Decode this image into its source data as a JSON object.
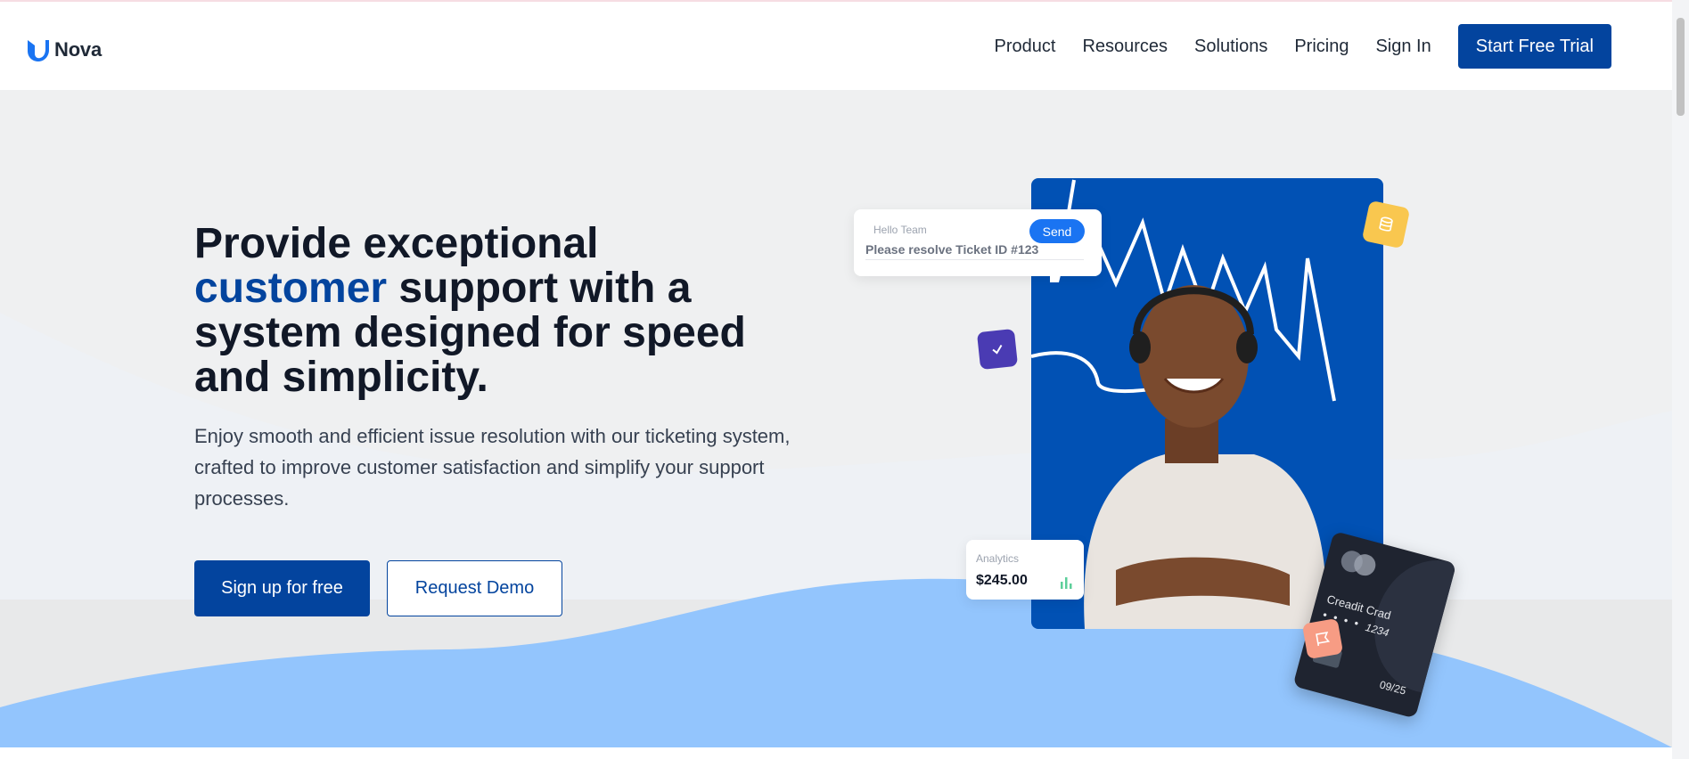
{
  "brand": {
    "name": "Nova",
    "logo_icon": "nova-logo-icon",
    "primary_color": "#03449e"
  },
  "nav": {
    "items": [
      "Product",
      "Resources",
      "Solutions",
      "Pricing",
      "Sign In"
    ],
    "cta": "Start Free Trial"
  },
  "hero": {
    "headline_before": "Provide exceptional",
    "headline_accent": "customer",
    "headline_after": "support with a system designed for speed and simplicity.",
    "subtext": "Enjoy smooth and efficient issue resolution with our ticketing system, crafted to improve customer satisfaction and simplify your support processes.",
    "primary_button": "Sign up for free",
    "secondary_button": "Request Demo"
  },
  "illustration": {
    "chat": {
      "greeting": "Hello Team",
      "message": "Please resolve Ticket ID #123",
      "send": "Send"
    },
    "analytics": {
      "label": "Analytics",
      "value": "$245.00",
      "icon": "bar-chart-icon"
    },
    "card": {
      "title": "Creadit Crad",
      "masked": "• • • •",
      "number": "1234",
      "expiry": "09/25"
    },
    "badges": [
      "database-icon",
      "check-icon",
      "flag-icon"
    ],
    "photo_bg_color": "#0151b4",
    "wave_color": "#93c5fd"
  }
}
